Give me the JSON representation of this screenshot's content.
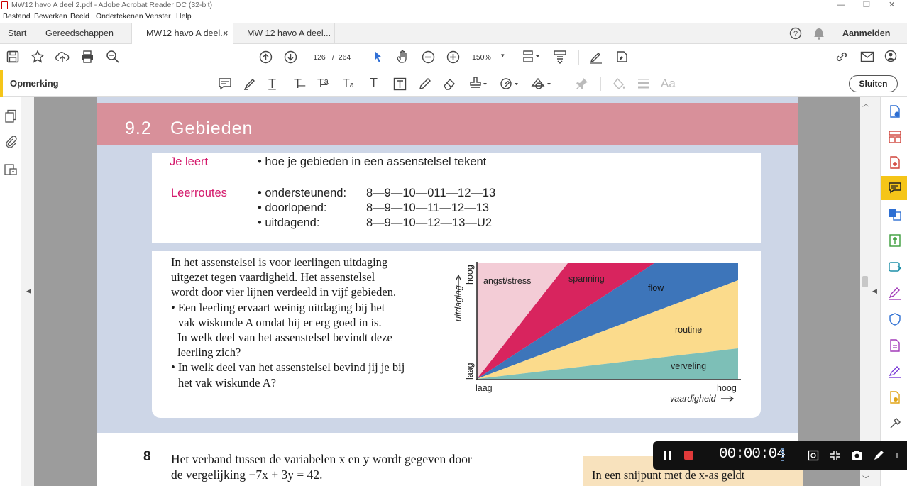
{
  "window": {
    "title": "MW12 havo A deel 2.pdf - Adobe Acrobat Reader DC (32-bit)"
  },
  "menu": [
    "Bestand",
    "Bewerken",
    "Beeld",
    "Ondertekenen",
    "Venster",
    "Help"
  ],
  "tabs": {
    "home": "Start",
    "tools": "Gereedschappen",
    "doc1": "MW12 havo A deel...",
    "doc1_close": "×",
    "doc2": "MW 12 havo A deel...",
    "signin": "Aanmelden"
  },
  "toolbar": {
    "page_current": "126",
    "page_sep": "/",
    "page_total": "264",
    "zoom": "150%"
  },
  "comment_bar": {
    "title": "Opmerking",
    "close_label": "Sluiten"
  },
  "page": {
    "section_number": "9.2",
    "section_title": "Gebieden",
    "je_leert_label": "Je leert",
    "je_leert_text": "• hoe je gebieden in een assenstelsel tekent",
    "leerroutes_label": "Leerroutes",
    "routes": [
      {
        "name": "• ondersteunend:",
        "path": "8—9—10—011—12—13"
      },
      {
        "name": "• doorlopend:",
        "path": "8—9—10—11—12—13"
      },
      {
        "name": "• uitdagend:",
        "path": "8—9—10—12—13—U2"
      }
    ],
    "paragraph_lines": [
      "In het assenstelsel is voor leerlingen uitdaging",
      "uitgezet tegen vaardigheid. Het assenstelsel",
      "wordt door vier lijnen verdeeld in vijf gebieden.",
      "• Een leerling ervaart weinig uitdaging bij het",
      "vak wiskunde A omdat hij er erg goed in is.",
      "In welk deel van het assenstelsel bevindt deze",
      "leerling zich?",
      "• In welk deel van het assenstelsel bevind jij je bij",
      "het vak wiskunde A?"
    ],
    "exercise_number": "8",
    "exercise_lines": [
      "Het verband tussen de variabelen x en y wordt gegeven door",
      "de vergelijking −7x + 3y = 42."
    ],
    "tip_text": "In een snijpunt met de x-as geldt"
  },
  "diagram": {
    "ylabel": "uitdaging",
    "y_high": "hoog",
    "y_low": "laag",
    "x_low": "laag",
    "x_high": "hoog",
    "xlabel": "vaardigheid",
    "regions": [
      "angst/stress",
      "spanning",
      "flow",
      "routine",
      "verveling"
    ],
    "colors": {
      "angst": "#f3ccd6",
      "spanning": "#d8245e",
      "flow": "#3d75ba",
      "routine": "#fbdb8c",
      "verveling": "#7dbfb7"
    }
  },
  "recorder": {
    "time": "00:00:04"
  }
}
